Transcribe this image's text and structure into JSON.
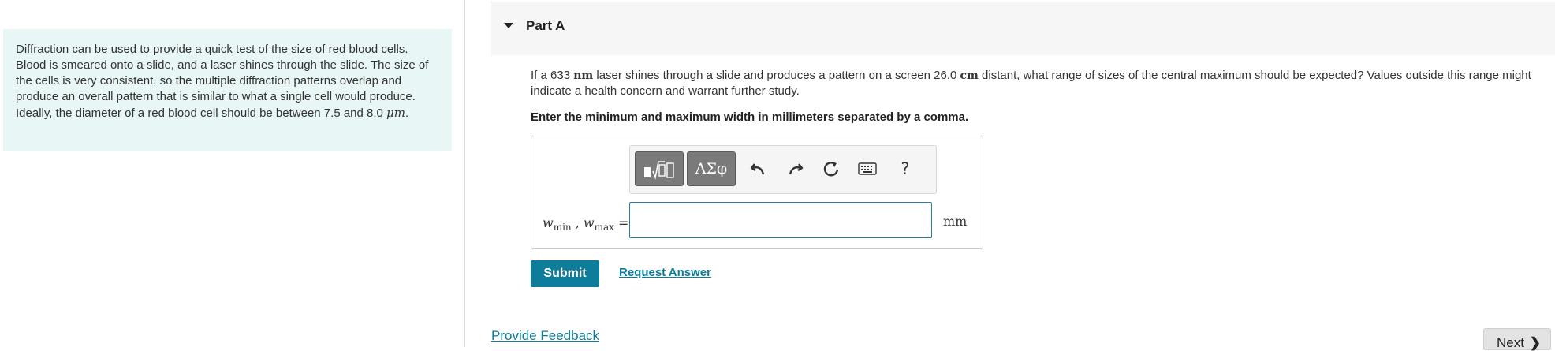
{
  "intro": {
    "text": "Diffraction can be used to provide a quick test of the size of red blood cells. Blood is smeared onto a slide, and a laser shines through the slide. The size of the cells is very consistent, so the multiple diffraction patterns overlap and produce an overall pattern that is similar to what a single cell would produce. Ideally, the diameter of a red blood cell should be between 7.5 and 8.0 ",
    "unit": "μm",
    "end": "."
  },
  "part": {
    "title": "Part A"
  },
  "question": {
    "pre": "If a 633 ",
    "unit1": "nm",
    "mid": " laser shines through a slide and produces a pattern on a screen 26.0 ",
    "unit2": "cm",
    "post": " distant, what range of sizes of the central maximum should be expected? Values outside this range might indicate a health concern and warrant further study."
  },
  "instruction": "Enter the minimum and maximum width in millimeters separated by a comma.",
  "toolbar": {
    "templates_icon": "templates-icon",
    "greek_label": "ΑΣφ",
    "undo_icon": "undo-icon",
    "redo_icon": "redo-icon",
    "reset_icon": "reset-icon",
    "keyboard_icon": "keyboard-icon",
    "help_label": "?"
  },
  "answer": {
    "var1": "w",
    "sub1": "min",
    "sep": " , ",
    "var2": "w",
    "sub2": "max",
    "eq": " =",
    "value": "",
    "unit": "mm"
  },
  "actions": {
    "submit_label": "Submit",
    "request_label": "Request Answer",
    "feedback_label": "Provide Feedback",
    "next_label": "Next"
  },
  "colors": {
    "accent": "#0e7c9b",
    "intro_bg": "#e8f6f6"
  }
}
